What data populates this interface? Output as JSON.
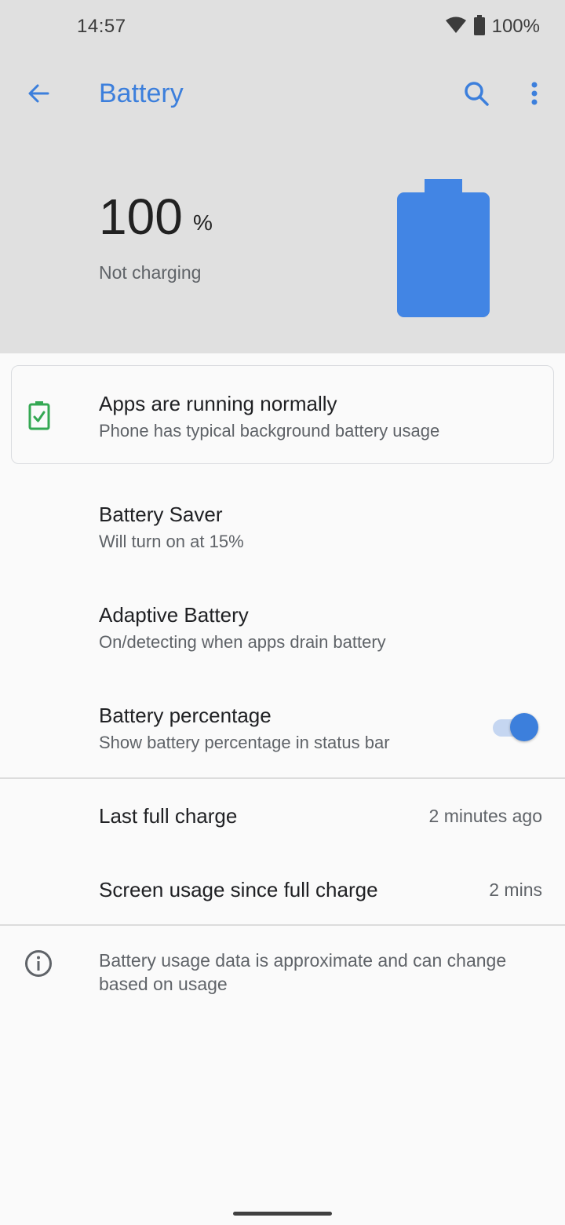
{
  "status_bar": {
    "time": "14:57",
    "battery_percent": "100%",
    "icons": [
      "wifi-icon",
      "battery-full-icon"
    ]
  },
  "toolbar": {
    "title": "Battery",
    "icons": [
      "back-arrow-icon",
      "search-icon",
      "more-vert-icon"
    ]
  },
  "battery": {
    "level": "100",
    "unit": "%",
    "status": "Not charging",
    "fill_fraction": 1.0
  },
  "tip_card": {
    "title": "Apps are running normally",
    "subtitle": "Phone has typical background battery usage",
    "icon": "battery-check-icon"
  },
  "settings": [
    {
      "title": "Battery Saver",
      "subtitle": "Will turn on at 15%"
    },
    {
      "title": "Adaptive Battery",
      "subtitle": "On/detecting when apps drain battery"
    },
    {
      "title": "Battery percentage",
      "subtitle": "Show battery percentage in status bar",
      "toggle_on": true
    }
  ],
  "usage": [
    {
      "label": "Last full charge",
      "value": "2 minutes ago"
    },
    {
      "label": "Screen usage since full charge",
      "value": "2 mins"
    }
  ],
  "footer": {
    "info_text": "Battery usage data is approximate and can change based on usage",
    "icon": "info-icon"
  },
  "colors": {
    "accent": "#3c7fdc",
    "header_bg": "#e0e0e0",
    "page_bg": "#fafafa",
    "success": "#34a853"
  }
}
